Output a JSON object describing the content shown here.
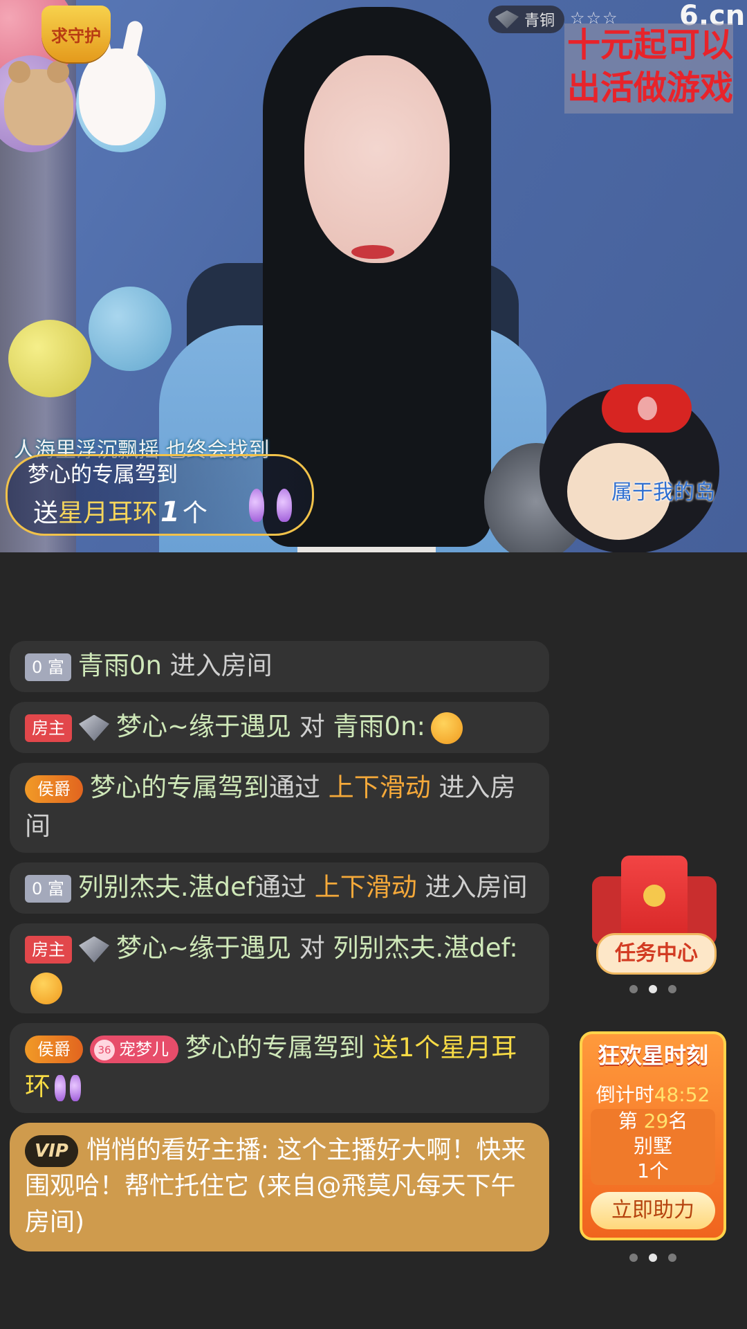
{
  "stream": {
    "guard_badge": "求守护",
    "rank_level": "青铜",
    "rank_stars": "☆☆☆",
    "site_logo": "6.cn",
    "notice_lines": [
      "十元起可以",
      "出活做游戏"
    ],
    "lyric_left": "人海里浮沉飘摇 也终会找到",
    "lyric_right": "属于我的岛",
    "gift_banner": {
      "sender": "梦心的专属驾到",
      "verb": "送",
      "gift_name": "星月耳环",
      "count": "1",
      "unit": "个"
    }
  },
  "chat": {
    "messages": [
      {
        "badge": "0 富",
        "name": "青雨0n",
        "text": " 进入房间"
      },
      {
        "badge": "房主",
        "name": "梦心~缘于遇见",
        "mid": " 对 ",
        "target": "青雨0n:"
      },
      {
        "badge": "侯爵",
        "name": "梦心的专属驾到",
        "text": "通过 ",
        "hl": "上下滑动",
        "tail": " 进入房间"
      },
      {
        "badge": "0 富",
        "name": "列别杰夫.湛def",
        "text": "通过 ",
        "hl": "上下滑动",
        "tail": " 进入房间"
      },
      {
        "badge": "房主",
        "name": "梦心~缘于遇见",
        "mid": " 对 ",
        "target": "列别杰夫.湛def:"
      },
      {
        "badge": "侯爵",
        "pet_level": "36",
        "pet_name": "宠梦儿",
        "name": "梦心的专属驾到",
        "gift_text": " 送1个星月耳环"
      }
    ],
    "vip": {
      "badge": "VIP",
      "text": "悄悄的看好主播: 这个主播好大啊！快来围观哈！帮忙托住它 (来自@飛莫凡每天下午房间)"
    }
  },
  "widgets": {
    "task_center": "任务中心",
    "carnival": {
      "title": "狂欢星时刻",
      "countdown_label": "倒计时",
      "countdown_time": "48:52",
      "rank_prefix": "第 ",
      "rank_num": "29",
      "rank_suffix": "名",
      "prize": "别墅",
      "prize_count": "1个",
      "button": "立即助力"
    }
  }
}
